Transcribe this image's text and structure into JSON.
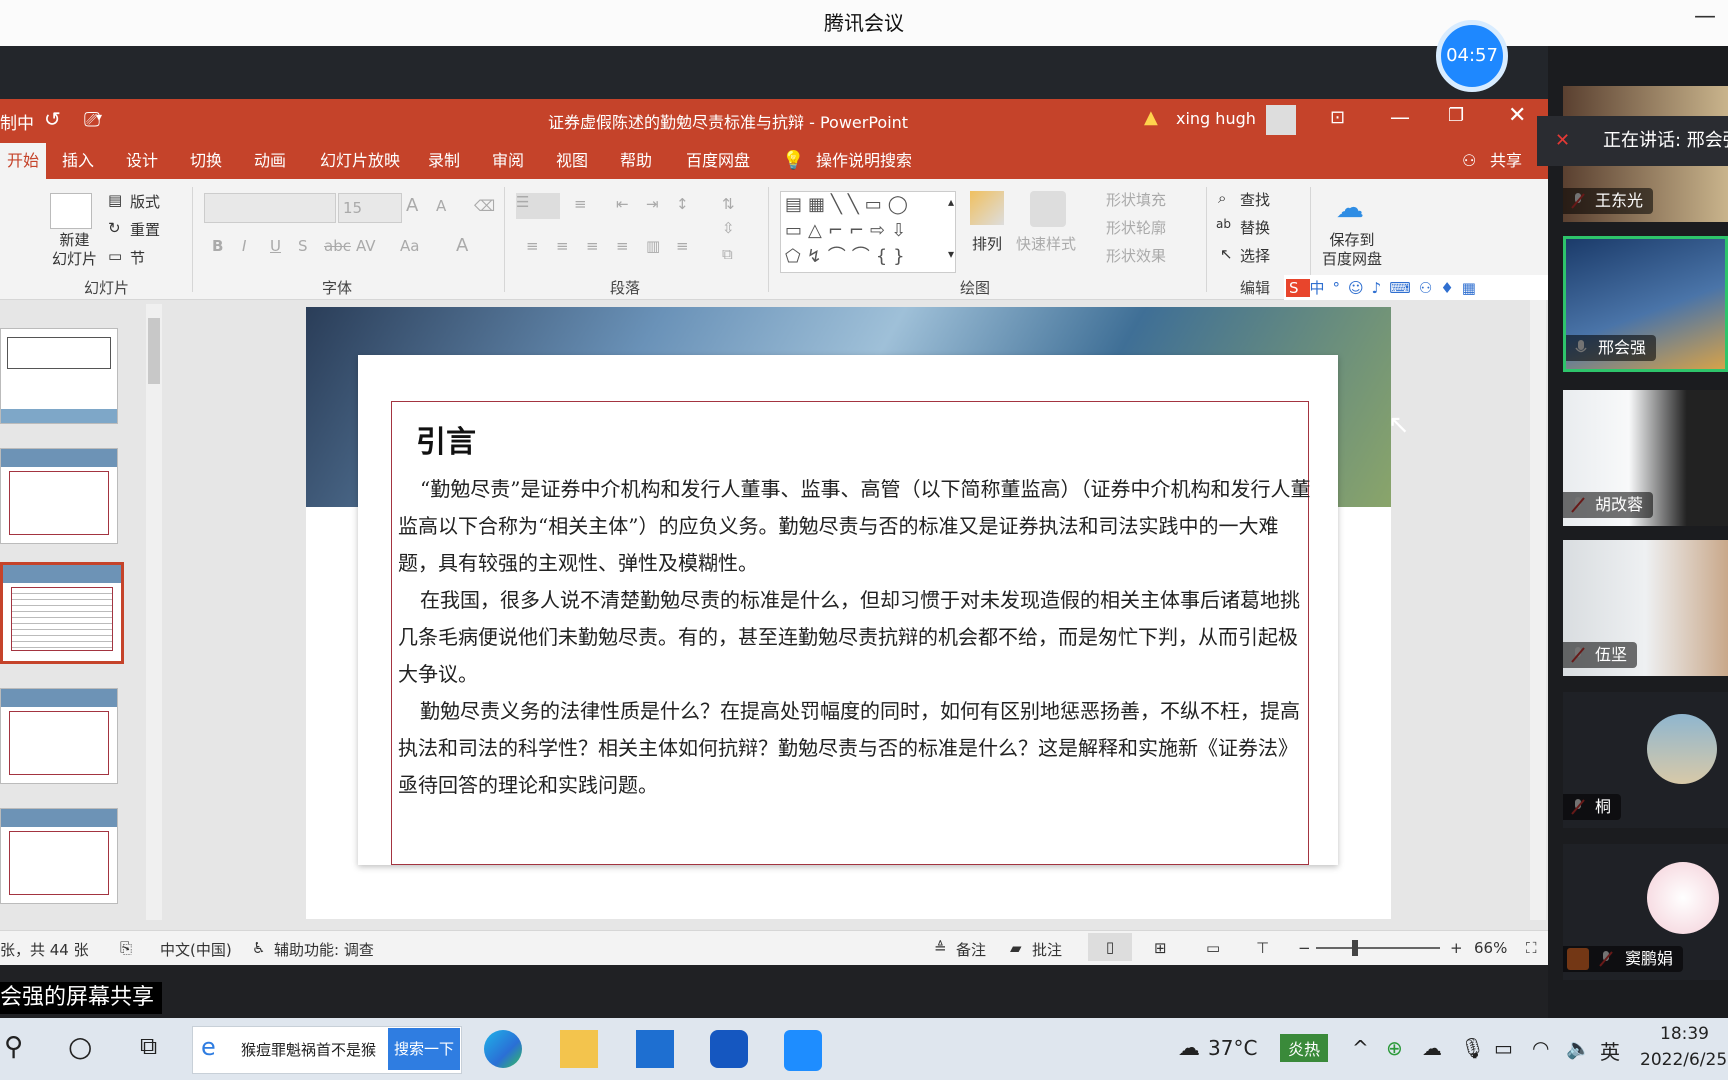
{
  "meeting": {
    "app_title": "腾讯会议",
    "timer": "04:57",
    "share_label": "会强的屏幕共享",
    "speaking_label": "正在讲话: 邢会强"
  },
  "ppt": {
    "title_left": "制中",
    "window_title": "证券虚假陈述的勤勉尽责标准与抗辩  -  PowerPoint",
    "user": "xing hugh",
    "tabs": [
      "开始",
      "插入",
      "设计",
      "切换",
      "动画",
      "幻灯片放映",
      "录制",
      "审阅",
      "视图",
      "帮助",
      "百度网盘"
    ],
    "tell_me": "操作说明搜索",
    "share": "共享",
    "ribbon": {
      "new_slide": "新建\n幻灯片",
      "layout": "版式",
      "reset": "重置",
      "section": "节",
      "group_slides": "幻灯片",
      "font_size": "15",
      "group_font": "字体",
      "group_paragraph": "段落",
      "arrange": "排列",
      "quick_styles": "快速样式",
      "shape_fill": "形状填充",
      "shape_outline": "形状轮廓",
      "shape_effects": "形状效果",
      "group_drawing": "绘图",
      "find": "查找",
      "replace": "替换",
      "select": "选择",
      "group_editing": "编辑",
      "save_baidu": "保存到\n百度网盘"
    },
    "slide": {
      "title": "引言",
      "paragraphs": [
        "“勤勉尽责”是证券中介机构和发行人董事、监事、高管（以下简称董监高）（证券中介机构和发行人董监高以下合称为“相关主体”）的应负义务。勤勉尽责与否的标准又是证券执法和司法实践中的一大难题，具有较强的主观性、弹性及模糊性。",
        "在我国，很多人说不清楚勤勉尽责的标准是什么，但却习惯于对未发现造假的相关主体事后诸葛地挑几条毛病便说他们未勤勉尽责。有的，甚至连勤勉尽责抗辩的机会都不给，而是匆忙下判，从而引起极大争议。",
        "勤勉尽责义务的法律性质是什么？在提高处罚幅度的同时，如何有区别地惩恶扬善，不纵不枉，提高执法和司法的科学性？相关主体如何抗辩？勤勉尽责与否的标准是什么？这是解释和实施新《证券法》亟待回答的理论和实践问题。"
      ]
    },
    "status": {
      "slide_count": "张，共 44 张",
      "language": "中文(中国)",
      "accessibility": "辅助功能: 调查",
      "notes": "备注",
      "comments": "批注",
      "zoom": "66%"
    }
  },
  "participants": [
    {
      "name": "王东光",
      "muted": true
    },
    {
      "name": "邢会强",
      "muted": false
    },
    {
      "name": "胡改蓉",
      "muted": true
    },
    {
      "name": "伍坚",
      "muted": true
    },
    {
      "name": "桐",
      "muted": true
    },
    {
      "name": "窦鹏娟",
      "muted": true
    }
  ],
  "taskbar": {
    "search_text": "猴痘罪魁祸首不是猴",
    "search_button": "搜索一下",
    "weather": "37°C",
    "weather_badge": "炎热",
    "ime": "英",
    "time": "18:39",
    "date": "2022/6/25"
  },
  "colors": {
    "ppt_accent": "#c5432a",
    "timer": "#1e88ff",
    "taskbar": "#dfe6ee",
    "slide_frame": "#a33440"
  }
}
